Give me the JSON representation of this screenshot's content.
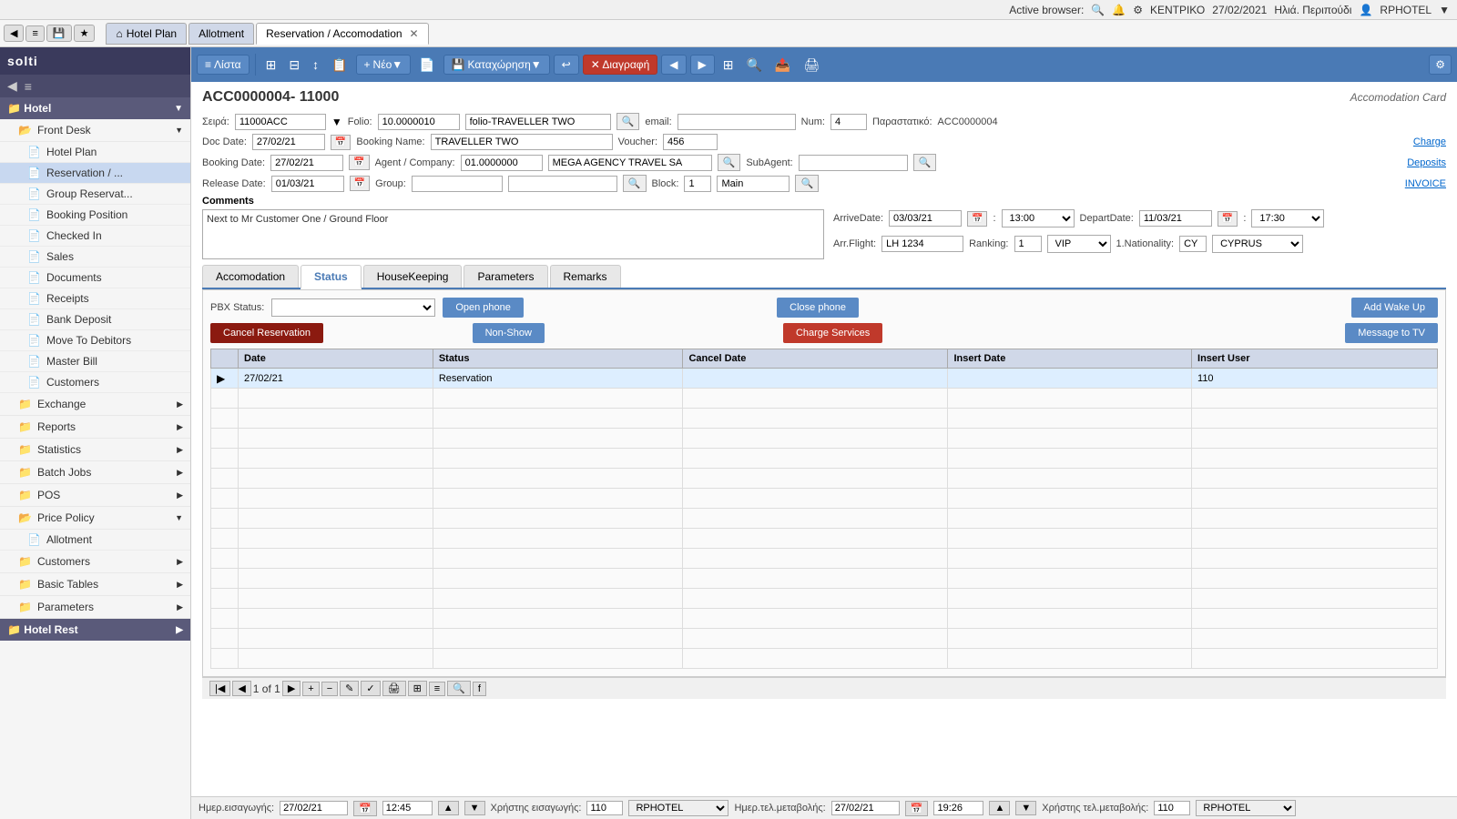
{
  "topbar": {
    "active_browser_label": "Active browser:",
    "date": "27/02/2021",
    "branch": "ΚΕΝΤΡΙΚΟ",
    "user_label": "Ηλιά. Περιπούδι",
    "user": "RPHOTEL"
  },
  "navbar": {
    "back_btn": "◀",
    "home_icon": "⌂",
    "tabs": [
      {
        "label": "Hotel Plan",
        "active": false
      },
      {
        "label": "Allotment",
        "active": false
      },
      {
        "label": "Reservation / Accomodation",
        "active": true
      }
    ]
  },
  "toolbar": {
    "list_btn": "Λίστα",
    "new_btn": "Νέο▼",
    "save_btn": "Καταχώρηση▼",
    "undo_btn": "↩",
    "delete_btn": "✕ Διαγραφή",
    "prev_btn": "◀",
    "next_btn": "▶",
    "zoom_btn": "🔍",
    "export_btn": "📤",
    "print_btn": "🖨"
  },
  "page": {
    "title": "ACC0000004- 11000",
    "card_label": "Accomodation Card",
    "seria_label": "Σειρά:",
    "seria_value": "11000ACC",
    "folio_label": "Folio:",
    "folio_value": "10.0000010",
    "folio_name": "folio-TRAVELLER TWO",
    "email_label": "email:",
    "email_value": "",
    "num_label": "Num:",
    "num_value": "4",
    "parastasiko_label": "Παραστατικό:",
    "parastasiko_value": "ACC0000004",
    "doc_date_label": "Doc Date:",
    "doc_date_value": "27/02/21",
    "booking_name_label": "Booking Name:",
    "booking_name_value": "TRAVELLER TWO",
    "voucher_label": "Voucher:",
    "voucher_value": "456",
    "charge_link": "Charge",
    "deposits_link": "Deposits",
    "invoice_link": "INVOICE",
    "booking_date_label": "Booking Date:",
    "booking_date_value": "27/02/21",
    "agent_label": "Agent / Company:",
    "agent_code": "01.0000000",
    "agent_name": "MEGA AGENCY TRAVEL SA",
    "subagent_label": "SubAgent:",
    "subagent_value": "",
    "release_date_label": "Release Date:",
    "release_date_value": "01/03/21",
    "group_label": "Group:",
    "group_value": "",
    "block_label": "Block:",
    "block_value": "1",
    "block_name": "Main",
    "comments_label": "Comments",
    "comments_value": "Next to Mr Customer One / Ground Floor",
    "arrive_date_label": "ArriveDate:",
    "arrive_date_value": "03/03/21",
    "arrive_time_value": "13:00",
    "depart_date_label": "DepartDate:",
    "depart_date_value": "11/03/21",
    "depart_time_value": "17:30",
    "arr_flight_label": "Arr.Flight:",
    "arr_flight_value": "LH 1234",
    "ranking_label": "Ranking:",
    "ranking_value": "1",
    "ranking_type": "VIP",
    "nationality_label": "1.Nationality:",
    "nationality_code": "CY",
    "nationality_value": "CYPRUS",
    "tabs": [
      {
        "label": "Accomodation",
        "active": false
      },
      {
        "label": "Status",
        "active": true
      },
      {
        "label": "HouseKeeping",
        "active": false
      },
      {
        "label": "Parameters",
        "active": false
      },
      {
        "label": "Remarks",
        "active": false
      }
    ],
    "pbx_status_label": "PBX Status:",
    "pbx_status_value": "",
    "btn_open_phone": "Open phone",
    "btn_close_phone": "Close phone",
    "btn_add_wake_up": "Add Wake Up",
    "btn_cancel_reservation": "Cancel Reservation",
    "btn_non_show": "Non-Show",
    "btn_charge_services": "Charge Services",
    "btn_message_tv": "Message to TV",
    "table_headers": [
      "Date",
      "Status",
      "Cancel Date",
      "Insert Date",
      "Insert User"
    ],
    "table_rows": [
      {
        "date": "27/02/21",
        "status": "Reservation",
        "cancel_date": "",
        "insert_date": "",
        "insert_user": "110",
        "selected": true
      }
    ],
    "page_indicator": "1 of 1",
    "footer_insert_date_label": "Ημερ.εισαγωγής:",
    "footer_insert_date": "27/02/21",
    "footer_insert_time": "12:45",
    "footer_insert_user_label": "Χρήστης εισαγωγής:",
    "footer_insert_user_code": "110",
    "footer_insert_user_name": "RPHOTEL",
    "footer_change_date_label": "Ημερ.τελ.μεταβολής:",
    "footer_change_date": "27/02/21",
    "footer_change_time": "19:26",
    "footer_change_user_label": "Χρήστης τελ.μεταβολής:",
    "footer_change_user_code": "110",
    "footer_change_user_name": "RPHOTEL"
  },
  "sidebar": {
    "logo": "solti",
    "groups": [
      {
        "label": "Hotel",
        "expanded": true,
        "items": [
          {
            "label": "Front Desk",
            "expanded": true,
            "subitems": [
              {
                "label": "Hotel Plan"
              },
              {
                "label": "Reservation / ...",
                "active": true
              },
              {
                "label": "Group Reservat..."
              },
              {
                "label": "Booking Position"
              },
              {
                "label": "Checked In"
              },
              {
                "label": "Sales"
              },
              {
                "label": "Documents"
              },
              {
                "label": "Receipts"
              },
              {
                "label": "Bank Deposit"
              },
              {
                "label": "Move To Debitors"
              },
              {
                "label": "Master Bill"
              },
              {
                "label": "Customers"
              }
            ]
          },
          {
            "label": "Exchange",
            "expanded": false,
            "subitems": []
          },
          {
            "label": "Reports",
            "expanded": false,
            "subitems": []
          },
          {
            "label": "Statistics",
            "expanded": false,
            "subitems": []
          },
          {
            "label": "Batch Jobs",
            "expanded": false,
            "subitems": []
          },
          {
            "label": "POS",
            "expanded": false,
            "subitems": []
          },
          {
            "label": "Price Policy",
            "expanded": true,
            "subitems": [
              {
                "label": "Allotment"
              }
            ]
          },
          {
            "label": "Customers",
            "expanded": false,
            "subitems": []
          },
          {
            "label": "Basic Tables",
            "expanded": false,
            "subitems": []
          },
          {
            "label": "Parameters",
            "expanded": false,
            "subitems": []
          }
        ]
      },
      {
        "label": "Hotel Rest",
        "expanded": false,
        "items": []
      }
    ]
  }
}
